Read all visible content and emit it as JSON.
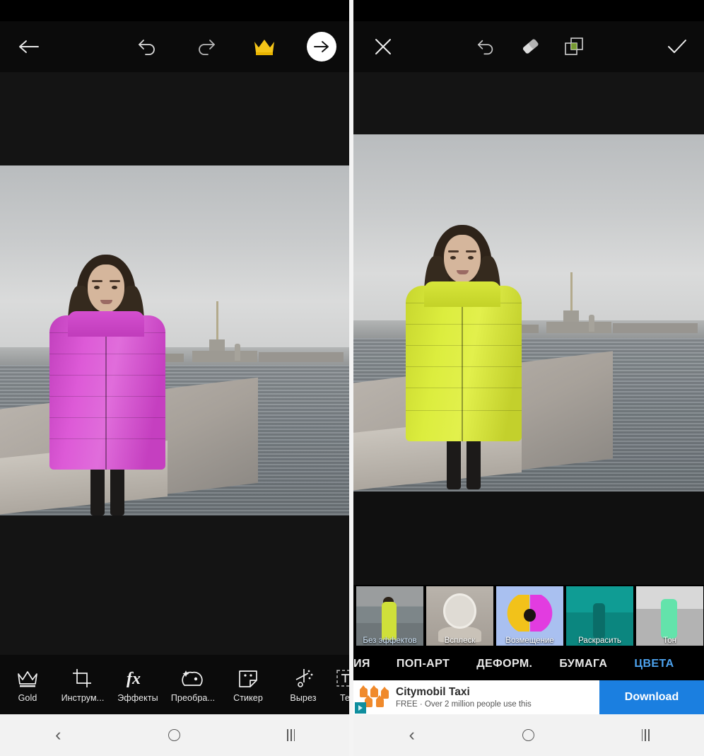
{
  "left_panel": {
    "toolbar": {
      "back_icon": "arrow-left-icon",
      "undo_icon": "undo-icon",
      "redo_icon": "redo-icon",
      "premium_icon": "gold-crown-icon",
      "next_icon": "arrow-right-circle-icon"
    },
    "photo": {
      "description": "Woman in magenta puffer coat standing on embankment by river with fortress skyline",
      "coat_color": "#d34fd0",
      "sky_color": "#cbcdce",
      "water_color": "#7e858a"
    },
    "tools": [
      {
        "label": "Gold",
        "icon": "crown-icon"
      },
      {
        "label": "Инструм...",
        "icon": "crop-icon"
      },
      {
        "label": "Эффекты",
        "icon": "fx-icon"
      },
      {
        "label": "Преобра...",
        "icon": "transform-face-icon"
      },
      {
        "label": "Стикер",
        "icon": "sticker-icon"
      },
      {
        "label": "Вырез",
        "icon": "cutout-scissors-icon"
      },
      {
        "label": "Те",
        "icon": "text-icon"
      }
    ]
  },
  "right_panel": {
    "toolbar": {
      "close_icon": "close-x-icon",
      "undo_icon": "undo-icon",
      "eraser_icon": "eraser-icon",
      "layers_icon": "layers-mask-icon",
      "confirm_icon": "checkmark-icon"
    },
    "photo": {
      "description": "Same photo with coat recolored to lime yellow",
      "coat_color": "#d6e63c"
    },
    "effect_thumbnails": [
      {
        "label": "Без эффектов",
        "selected": true,
        "art": "none"
      },
      {
        "label": "Всплеск",
        "selected": false,
        "art": "splash"
      },
      {
        "label": "Возмещение",
        "selected": false,
        "art": "replace"
      },
      {
        "label": "Раскрасить",
        "selected": false,
        "art": "colorize"
      },
      {
        "label": "Тон",
        "selected": false,
        "art": "tone"
      }
    ],
    "category_tabs": [
      {
        "label": "ИЯ",
        "active": false,
        "clipped": true
      },
      {
        "label": "ПОП-АРТ",
        "active": false,
        "clipped": false
      },
      {
        "label": "ДЕФОРМ.",
        "active": false,
        "clipped": false
      },
      {
        "label": "БУМАГА",
        "active": false,
        "clipped": false
      },
      {
        "label": "ЦВЕТА",
        "active": true,
        "clipped": false
      }
    ],
    "selection_color": "#4da3ef",
    "ad": {
      "icon": "orange-map-pins-icon",
      "adchoices_icon": "adchoices-badge-icon",
      "title": "Citymobil Taxi",
      "subtitle": "FREE · Over 2 million people use this",
      "cta_label": "Download",
      "cta_color": "#1b7fe0"
    }
  },
  "nav_bar": {
    "back_icon": "nav-back-icon",
    "home_icon": "nav-home-icon",
    "recents_icon": "nav-recents-icon"
  }
}
